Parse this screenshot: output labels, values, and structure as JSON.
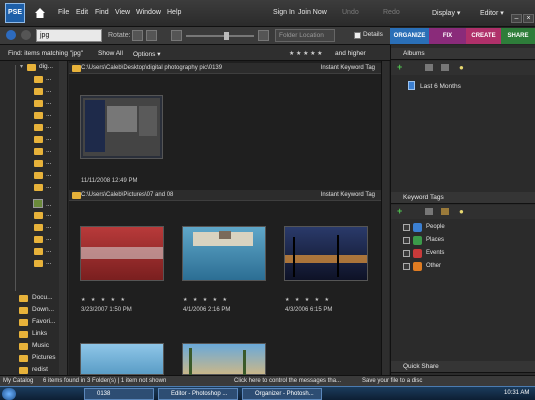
{
  "app": {
    "logo_text": "PSE"
  },
  "menu": {
    "items": [
      "File",
      "Edit",
      "Find",
      "View",
      "Window",
      "Help"
    ],
    "right": {
      "sign_in": "Sign In",
      "join_now": "Join Now",
      "undo": "Undo",
      "redo": "Redo",
      "display": "Display ▾",
      "editor": "Editor ▾"
    }
  },
  "toolbar": {
    "search_value": "jpg",
    "rotate_label": "Rotate:",
    "folder_location": "Folder Location",
    "details_label": "Details"
  },
  "tabs": [
    {
      "label": "ORGANIZE",
      "color": "#2a6fb7"
    },
    {
      "label": "FIX",
      "color": "#8a2b7a"
    },
    {
      "label": "CREATE",
      "color": "#b0306a"
    },
    {
      "label": "SHARE",
      "color": "#2e7d3a"
    }
  ],
  "findbar": {
    "find_text": "Find: items matching \"jpg\"",
    "show_all": "Show All",
    "options": "Options ▾",
    "stars": "★ ★ ★ ★ ★",
    "and_higher": "and higher"
  },
  "tree": {
    "top_folder": "dig...",
    "item_ellipsis": "...",
    "folders": [
      "Docu...",
      "Down...",
      "Favori...",
      "Links",
      "Music",
      "Pictures",
      "redist"
    ]
  },
  "groups": [
    {
      "path": "C:\\Users\\Caleb\\Desktop\\digital photography pic\\0139",
      "keyword": "Instant Keyword Tag"
    },
    {
      "path": "C:\\Users\\Caleb\\Pictures\\07 and 08",
      "keyword": "Instant Keyword Tag"
    }
  ],
  "thumbs": [
    {
      "date": "11/11/2008 12:49 PM",
      "stars": "★ ★ ★ ★ ★"
    },
    {
      "date": "3/23/2007 1:50 PM",
      "stars": "★ ★ ★ ★ ★"
    },
    {
      "date": "4/1/2006 2:16 PM",
      "stars": "★ ★ ★ ★ ★"
    },
    {
      "date": "4/3/2006 6:15 PM",
      "stars": "★ ★ ★ ★ ★"
    }
  ],
  "panel": {
    "albums_title": "Albums",
    "album_item": "Last 6 Months",
    "keyword_title": "Keyword Tags",
    "keywords": [
      {
        "label": "People",
        "color": "#3b7fd1"
      },
      {
        "label": "Places",
        "color": "#3b9b4a"
      },
      {
        "label": "Events",
        "color": "#c83a3a"
      },
      {
        "label": "Other",
        "color": "#e07c22"
      }
    ],
    "quick_share": "Quick Share"
  },
  "status": {
    "catalog": "My Catalog",
    "found": "6 items found in 3 Folder(s) | 1 item not shown",
    "message": "Click here to control the messages tha...",
    "save": "Save your file to a disc"
  },
  "taskbar": {
    "tasks": [
      "0138",
      "Editor - Photoshop ...",
      "Organizer - Photosh..."
    ],
    "time": "10:31 AM"
  }
}
